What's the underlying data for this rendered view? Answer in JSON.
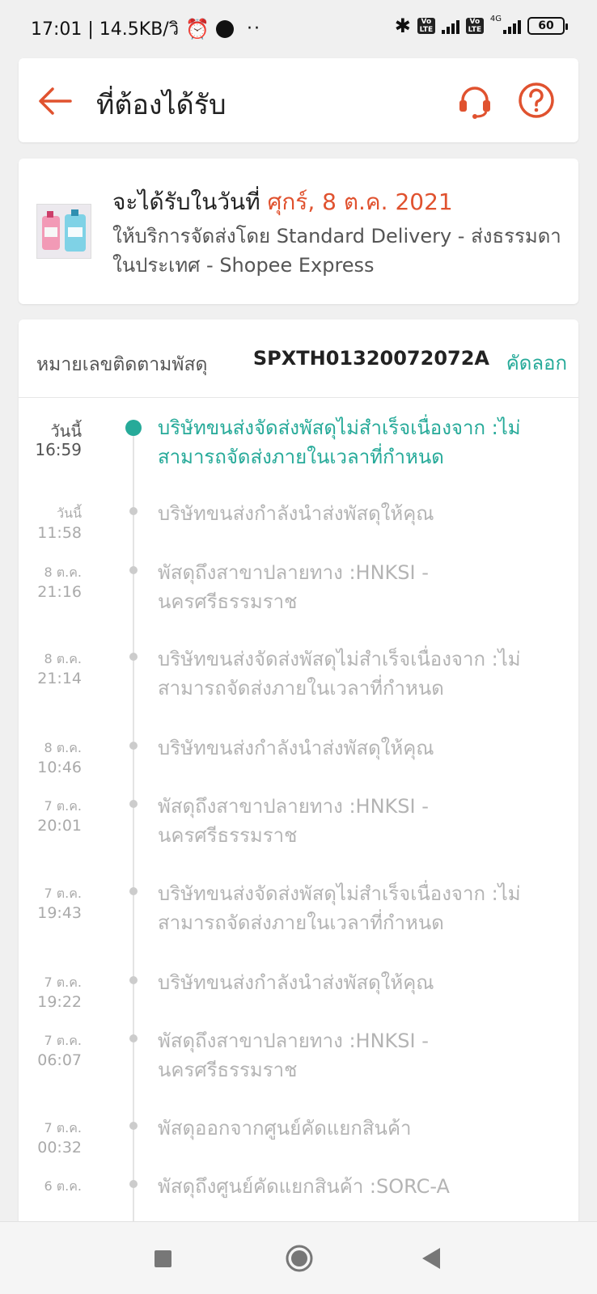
{
  "status_bar": {
    "time_speed": "17:01 | 14.5KB/วิ",
    "more": "··",
    "volte_1": "Vo LTE",
    "volte_2": "Vo LTE",
    "network": "4G",
    "battery": "60"
  },
  "header": {
    "title": "ที่ต้องได้รับ",
    "icons": [
      "back-arrow-icon",
      "headset-support-icon",
      "help-question-icon"
    ],
    "accent_color": "#e0522f"
  },
  "delivery": {
    "title_prefix": "จะได้รับในวันที่ ",
    "date": "ศุกร์, 8 ต.ค. 2021",
    "service": "ให้บริการจัดส่งโดย Standard Delivery - ส่งธรรมดาในประเทศ - Shopee Express"
  },
  "tracking": {
    "label": "หมายเลขติดตามพัสดุ",
    "number": "SPXTH01320072072A",
    "copy_label": "คัดลอก",
    "highlight_color": "#26aa99",
    "events": [
      {
        "day": "วันนี้",
        "time": "16:59",
        "text": "บริษัทขนส่งจัดส่งพัสดุไม่สำเร็จเนื่องจาก :ไม่สามารถจัดส่งภายในเวลาที่กำหนด"
      },
      {
        "day": "วันนี้",
        "time": "11:58",
        "text": "บริษัทขนส่งกำลังนำส่งพัสดุให้คุณ"
      },
      {
        "day": "8 ต.ค.",
        "time": "21:16",
        "text": "พัสดุถึงสาขาปลายทาง :HNKSI - นครศรีธรรมราช"
      },
      {
        "day": "8 ต.ค.",
        "time": "21:14",
        "text": "บริษัทขนส่งจัดส่งพัสดุไม่สำเร็จเนื่องจาก :ไม่สามารถจัดส่งภายในเวลาที่กำหนด"
      },
      {
        "day": "8 ต.ค.",
        "time": "10:46",
        "text": "บริษัทขนส่งกำลังนำส่งพัสดุให้คุณ"
      },
      {
        "day": "7 ต.ค.",
        "time": "20:01",
        "text": "พัสดุถึงสาขาปลายทาง :HNKSI - นครศรีธรรมราช"
      },
      {
        "day": "7 ต.ค.",
        "time": "19:43",
        "text": "บริษัทขนส่งจัดส่งพัสดุไม่สำเร็จเนื่องจาก :ไม่สามารถจัดส่งภายในเวลาที่กำหนด"
      },
      {
        "day": "7 ต.ค.",
        "time": "19:22",
        "text": "บริษัทขนส่งกำลังนำส่งพัสดุให้คุณ"
      },
      {
        "day": "7 ต.ค.",
        "time": "06:07",
        "text": "พัสดุถึงสาขาปลายทาง :HNKSI - นครศรีธรรมราช"
      },
      {
        "day": "7 ต.ค.",
        "time": "00:32",
        "text": "พัสดุออกจากศูนย์คัดแยกสินค้า"
      },
      {
        "day": "6 ต.ค.",
        "time": "",
        "text": "พัสดุถึงศูนย์คัดแยกสินค้า :SORC-A"
      }
    ]
  },
  "nav_bar": {
    "icons": [
      "recents-square-icon",
      "home-circle-icon",
      "back-triangle-icon"
    ]
  }
}
